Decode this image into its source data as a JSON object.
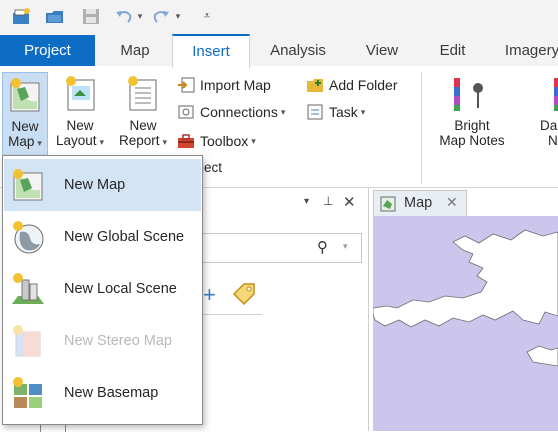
{
  "quick_access": {
    "icons": [
      "new-project-icon",
      "open-project-icon",
      "save-project-icon",
      "undo-icon",
      "redo-icon",
      "customize-qat-icon"
    ]
  },
  "tabs": [
    {
      "label": "Project"
    },
    {
      "label": "Map"
    },
    {
      "label": "Insert"
    },
    {
      "label": "Analysis"
    },
    {
      "label": "View"
    },
    {
      "label": "Edit"
    },
    {
      "label": "Imagery"
    }
  ],
  "ribbon": {
    "new_map": {
      "line1": "New",
      "line2": "Map"
    },
    "new_layout": {
      "line1": "New",
      "line2": "Layout"
    },
    "new_report": {
      "line1": "New",
      "line2": "Report"
    },
    "import_map": "Import Map",
    "connections": "Connections",
    "toolbox": "Toolbox",
    "add_folder": "Add Folder",
    "task": "Task",
    "project_group_partial": "ject",
    "bright_map_notes": {
      "line1": "Bright",
      "line2": "Map Notes"
    },
    "dark_partial": {
      "line1": "Da",
      "line2": "N"
    }
  },
  "menu": {
    "items": [
      {
        "label": "New Map",
        "state": "highlighted"
      },
      {
        "label": "New Global Scene",
        "state": "normal"
      },
      {
        "label": "New Local Scene",
        "state": "normal"
      },
      {
        "label": "New Stereo Map",
        "state": "disabled"
      },
      {
        "label": "New Basemap",
        "state": "normal"
      }
    ]
  },
  "map_view": {
    "tab_label": "Map"
  },
  "colors": {
    "accent": "#0d6dc4",
    "menu_highlight": "#d3e4f4",
    "map_land": "#ffffff",
    "map_water": "#cdc6ec"
  }
}
